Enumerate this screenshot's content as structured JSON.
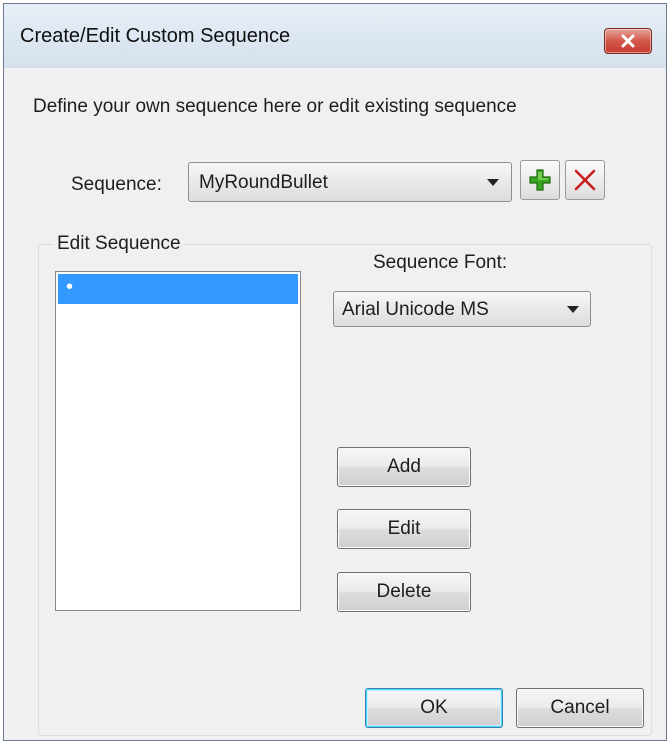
{
  "dialog": {
    "title": "Create/Edit Custom Sequence",
    "intro": "Define your own sequence here or edit existing sequence"
  },
  "sequence": {
    "label": "Sequence:",
    "selected": "MyRoundBullet",
    "add_icon": "green-plus-icon",
    "delete_icon": "red-x-icon"
  },
  "edit_group": {
    "legend": "Edit Sequence",
    "items": [
      "•"
    ],
    "font_label": "Sequence Font:",
    "font_selected": "Arial Unicode MS",
    "buttons": {
      "add": "Add",
      "edit": "Edit",
      "delete": "Delete"
    }
  },
  "footer": {
    "ok": "OK",
    "cancel": "Cancel"
  },
  "colors": {
    "selection": "#3399ff",
    "close_button": "#c43d2f",
    "add_icon": "#3aa51f",
    "delete_icon": "#c81e1e"
  }
}
